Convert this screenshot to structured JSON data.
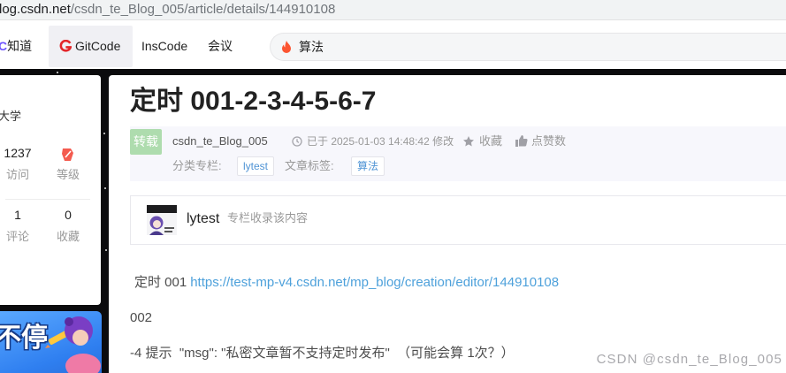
{
  "url_bar": {
    "host": "log.csdn.net",
    "path": "/csdn_te_Blog_005/article/details/144910108"
  },
  "nav": {
    "c_know": {
      "label": "C知道"
    },
    "gitcode": {
      "icon": "gitcode-logo-icon",
      "label": "GitCode"
    },
    "inscode": {
      "label": "InsCode"
    },
    "meeting": {
      "label": "会议"
    },
    "search": {
      "icon": "fire-icon",
      "value": "算法"
    }
  },
  "sidebar": {
    "org": "大学",
    "visits": {
      "value": "1237",
      "label": "访问"
    },
    "level": {
      "icon": "level-badge-icon",
      "label": "等级"
    },
    "comments": {
      "value": "1",
      "label": "评论"
    },
    "favorites": {
      "value": "0",
      "label": "收藏"
    },
    "banner": {
      "text": "不停"
    }
  },
  "article": {
    "title": "定时 001-2-3-4-5-6-7",
    "info": {
      "badge": "转载",
      "author": "csdn_te_Blog_005",
      "modified": "已于 2025-01-03 14:48:42 修改",
      "collect_label": "收藏",
      "like_label": "点赞数",
      "category_label": "分类专栏:",
      "category_tag": "lytest",
      "tags_label": "文章标签:",
      "tag": "算法"
    },
    "column": {
      "name": "lytest",
      "desc": "专栏收录该内容"
    },
    "body": {
      "line1_text": "定时 001",
      "line1_link": "https://test-mp-v4.csdn.net/mp_blog/creation/editor/144910108",
      "line2": "002",
      "line3": "-4 提示  \"msg\": \"私密文章暂不支持定时发布\"  （可能会算 1次？）"
    }
  },
  "watermark": "CSDN @csdn_te_Blog_005",
  "colors": {
    "link": "#4ea1db",
    "tag_text": "#5094d5",
    "fire": "#fc5531",
    "reprint_badge": "#aedcae",
    "level_badge": "#f45b4f",
    "gitcode": "#e3262a",
    "page_background": "#0b0b0d"
  }
}
